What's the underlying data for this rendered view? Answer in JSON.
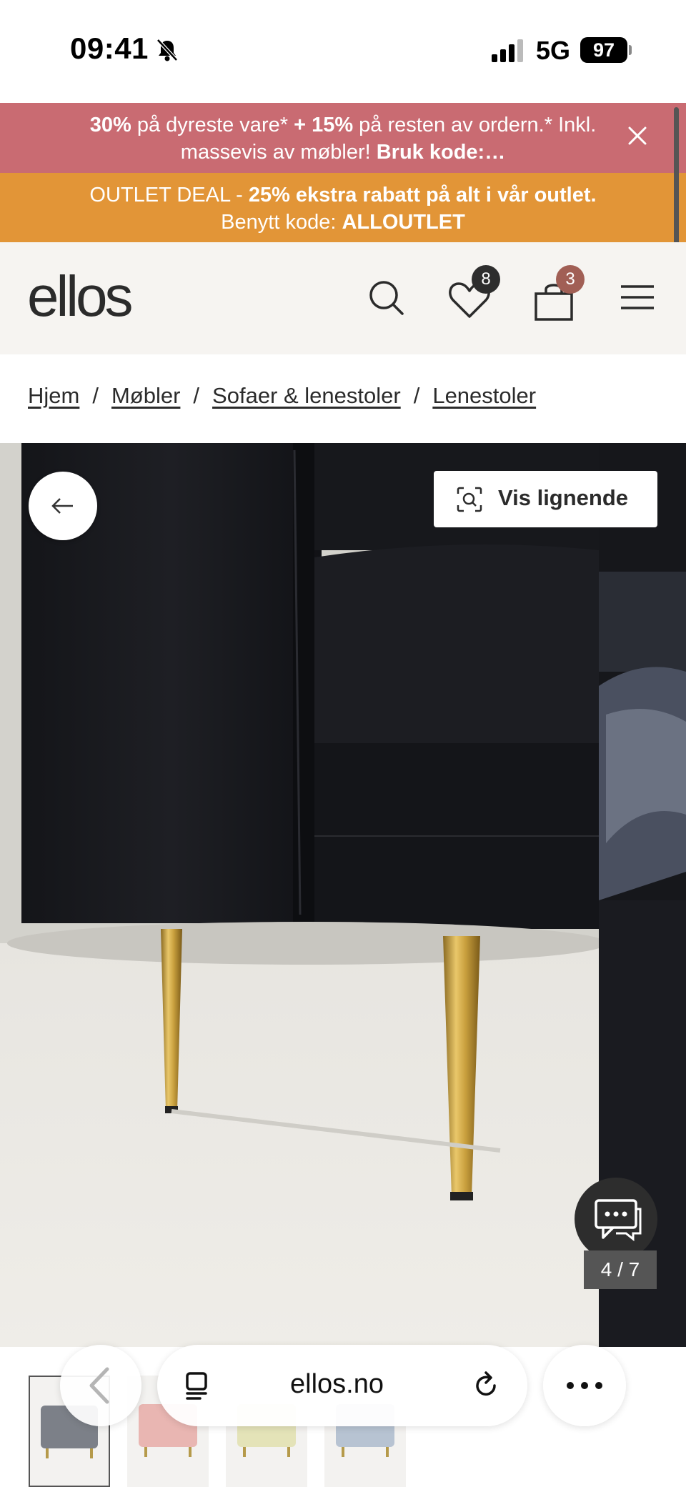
{
  "status_bar": {
    "time": "09:41",
    "network": "5G",
    "battery": "97"
  },
  "promo_banner": {
    "pct1": "30%",
    "text1": " på dyreste vare* ",
    "pct2": "+ 15%",
    "text2": " på resten av ordern.* Inkl. massevis av møbler! ",
    "code_label": "Bruk kode:…"
  },
  "outlet_banner": {
    "lead": "OUTLET DEAL - ",
    "highlight": "25% ekstra rabatt på alt i vår outlet.",
    "text": " Benytt kode: ",
    "code": "ALLOUTLET"
  },
  "header": {
    "logo": "ellos",
    "wishlist_count": "8",
    "cart_count": "3"
  },
  "breadcrumb": {
    "items": [
      "Hjem",
      "Møbler",
      "Sofaer & lenestoler",
      "Lenestoler"
    ],
    "separator": "/"
  },
  "gallery": {
    "similar_label": "Vis lignende",
    "counter": "4 / 7"
  },
  "browser": {
    "url": "ellos.no"
  },
  "colors": {
    "promo_pink": "#c96b72",
    "promo_orange": "#e29537",
    "header_bg": "#f6f4f1",
    "wishlist_badge": "#2d2d2d",
    "cart_badge": "#a15f55"
  },
  "icons": [
    "bell-mute-icon",
    "signal-icon",
    "close-icon",
    "search-icon",
    "heart-icon",
    "bag-icon",
    "menu-icon",
    "arrow-left-icon",
    "visual-search-icon",
    "chat-icon",
    "chevron-left-icon",
    "reader-icon",
    "reload-icon",
    "more-icon"
  ]
}
